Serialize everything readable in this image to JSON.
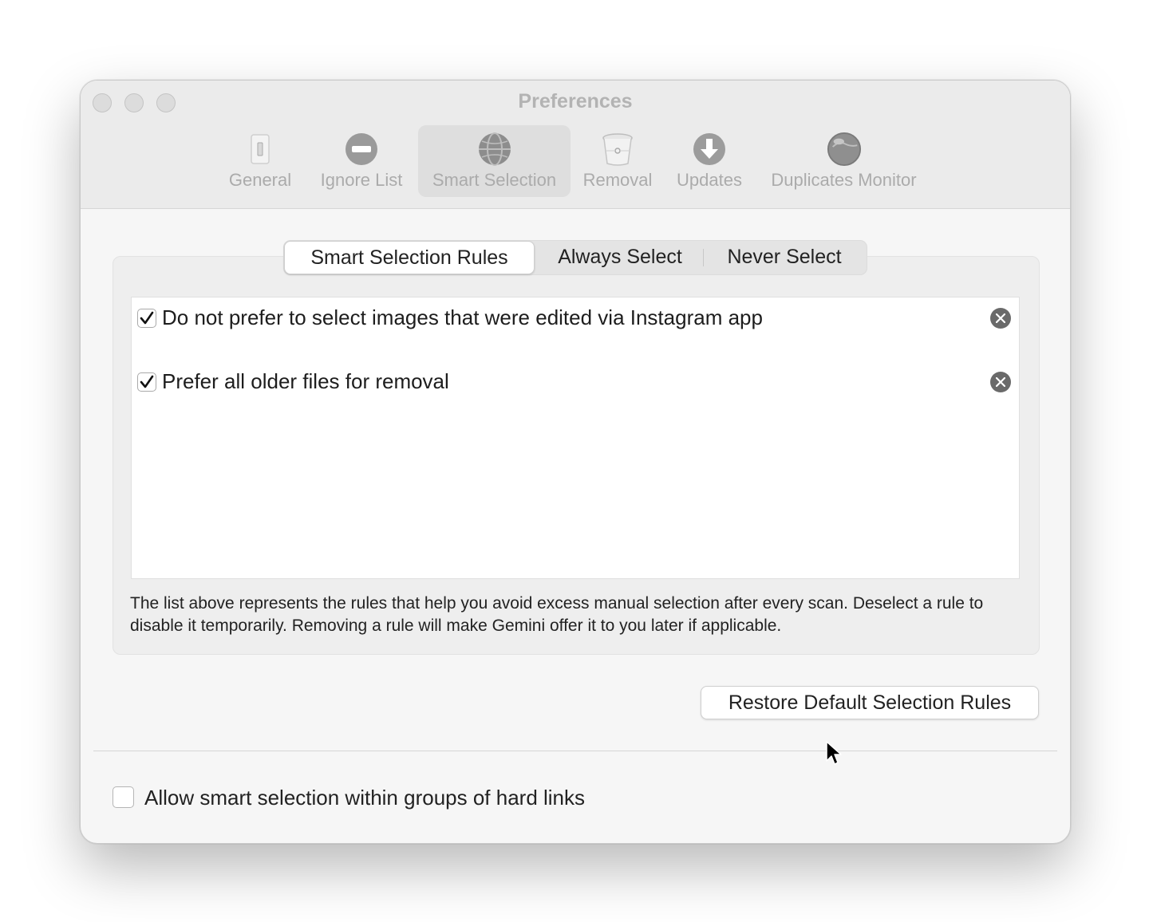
{
  "window": {
    "title": "Preferences"
  },
  "toolbar": {
    "items": [
      {
        "label": "General",
        "icon": "switch-icon",
        "selected": false
      },
      {
        "label": "Ignore List",
        "icon": "minus-circle-icon",
        "selected": false
      },
      {
        "label": "Smart Selection",
        "icon": "globe-icon",
        "selected": true
      },
      {
        "label": "Removal",
        "icon": "trash-icon",
        "selected": false
      },
      {
        "label": "Updates",
        "icon": "download-arrow-icon",
        "selected": false
      },
      {
        "label": "Duplicates Monitor",
        "icon": "monitor-sphere-icon",
        "selected": false
      }
    ]
  },
  "tabs": {
    "items": [
      "Smart Selection Rules",
      "Always Select",
      "Never Select"
    ],
    "active": "Smart Selection Rules"
  },
  "rules": [
    {
      "text": "Do not prefer to select images that were edited via Instagram app",
      "checked": true
    },
    {
      "text": "Prefer all older files for removal",
      "checked": true
    }
  ],
  "description": "The list above represents the rules that help you avoid excess manual selection after every scan. Deselect a rule to disable it temporarily. Removing a rule will make Gemini offer it to you later if applicable.",
  "restore_button": "Restore Default Selection Rules",
  "hard_links_option": {
    "label": "Allow smart selection within groups of hard links",
    "checked": false
  },
  "colors": {
    "window_bg": "#f6f6f6",
    "titlebar_bg": "#ebebeb",
    "inactive_text": "#ababab",
    "remove_button": "#6a6a6a"
  }
}
